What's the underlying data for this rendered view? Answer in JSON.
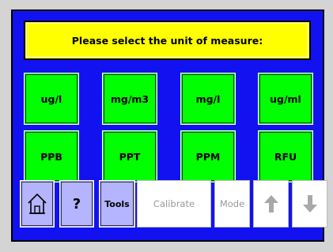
{
  "prompt": {
    "text": "Please select the unit of measure:"
  },
  "units": [
    "ug/l",
    "mg/m3",
    "mg/l",
    "ug/ml",
    "PPB",
    "PPT",
    "PPM",
    "RFU"
  ],
  "toolbar": {
    "home_icon": "home-icon",
    "help_label": "?",
    "tools_label": "Tools",
    "calibrate_label": "Calibrate",
    "mode_label": "Mode",
    "up_icon": "arrow-up-icon",
    "down_icon": "arrow-down-icon"
  },
  "colors": {
    "screen_bg": "#1212f0",
    "prompt_bg": "#ffff00",
    "unit_button": "#00ff00",
    "nav_button": "#b4b4ff",
    "disabled_text": "#9a9a9a"
  }
}
